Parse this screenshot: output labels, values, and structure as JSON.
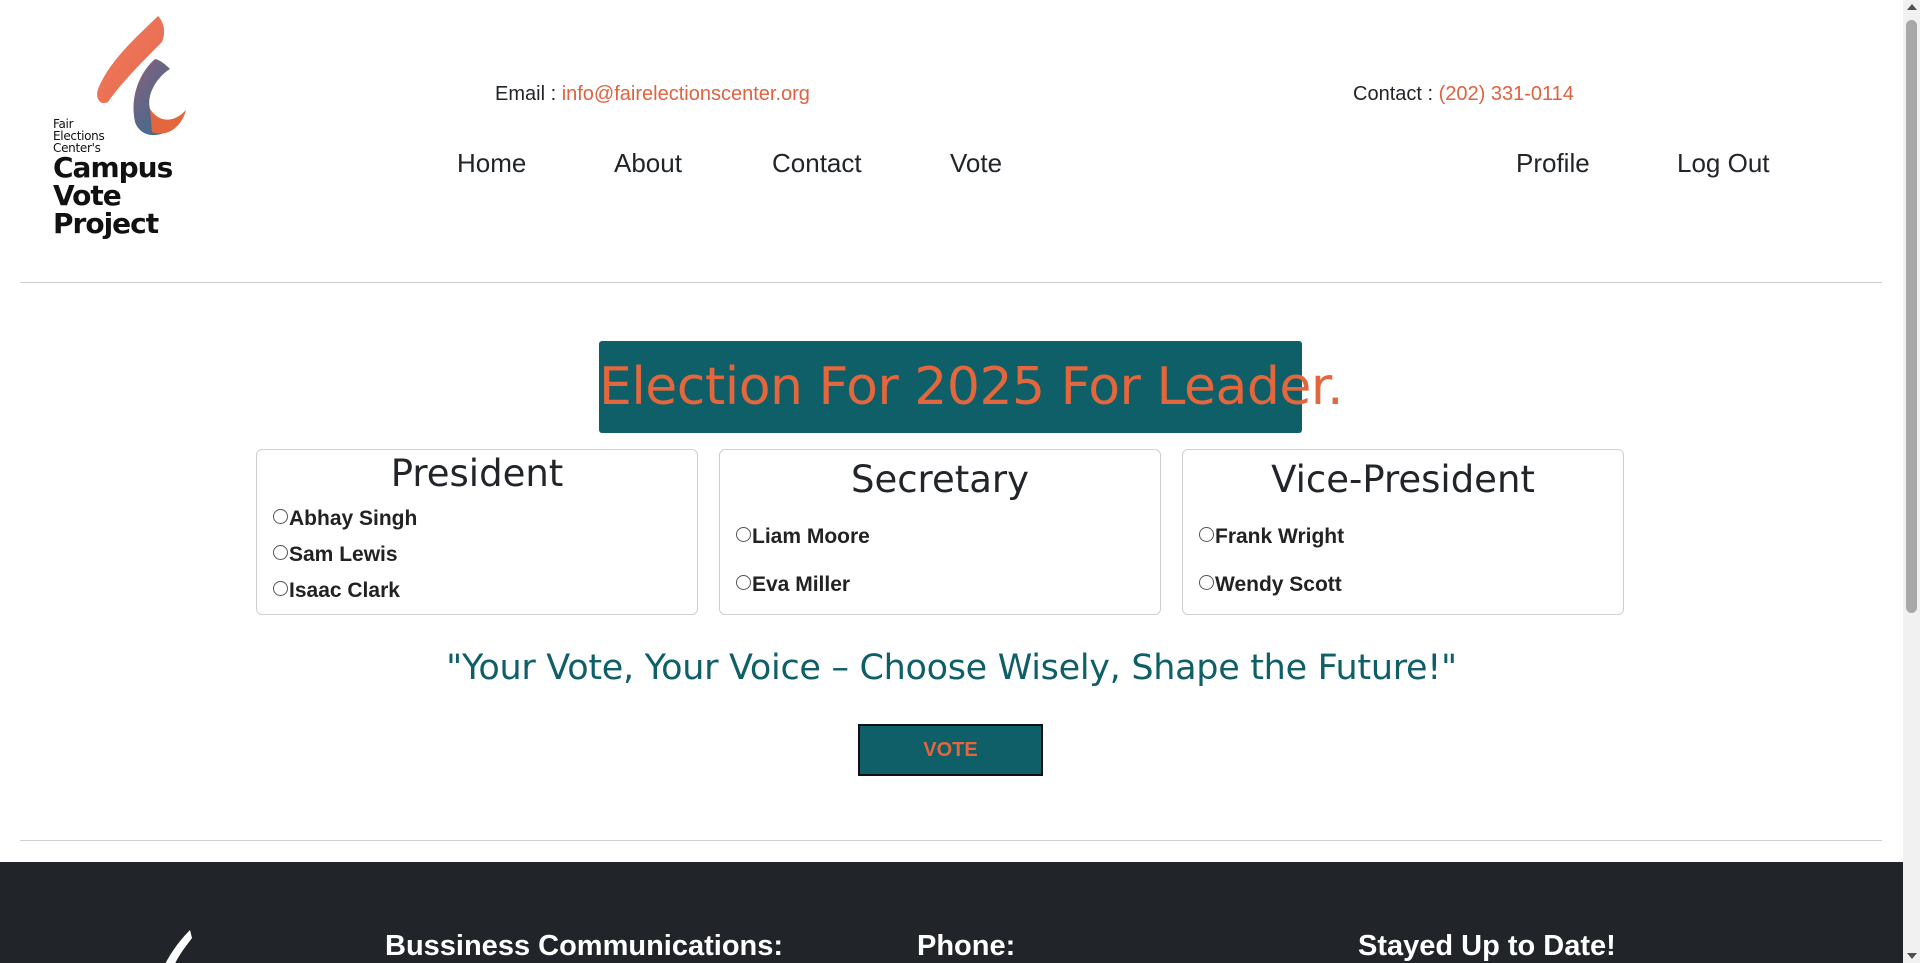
{
  "header": {
    "logo": {
      "line1": "Fair",
      "line2": "Elections",
      "line3": "Center's",
      "line4": "Campus",
      "line5": "Vote",
      "line6": "Project"
    },
    "email_label": "Email : ",
    "email_value": "info@fairelectionscenter.org",
    "contact_label": "Contact : ",
    "contact_value": "(202) 331-0114",
    "nav": {
      "home": "Home",
      "about": "About",
      "contact": "Contact",
      "vote": "Vote",
      "profile": "Profile",
      "logout": "Log Out"
    }
  },
  "main": {
    "title": "Election For 2025 For Leader.",
    "cards": [
      {
        "title": "President",
        "options": [
          "Abhay Singh",
          "Sam Lewis",
          "Isaac Clark"
        ]
      },
      {
        "title": "Secretary",
        "options": [
          "Liam Moore",
          "Eva Miller"
        ]
      },
      {
        "title": "Vice-President",
        "options": [
          "Frank Wright",
          "Wendy Scott"
        ]
      }
    ],
    "slogan": "\"Your Vote, Your Voice – Choose Wisely, Shape the Future!\"",
    "vote_button": "VOTE"
  },
  "footer": {
    "business": "Bussiness Communications:",
    "phone": "Phone:",
    "updates": "Stayed Up to Date!"
  },
  "colors": {
    "brand_teal": "#0e5f67",
    "brand_orange": "#e3663c",
    "footer_bg": "#212529"
  }
}
